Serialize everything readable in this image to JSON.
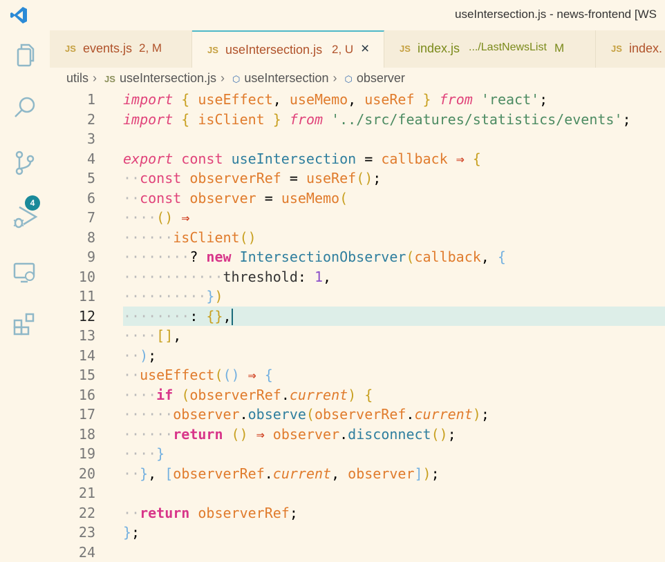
{
  "window": {
    "title": "useIntersection.js - news-frontend [WS"
  },
  "activity_bar": {
    "items": [
      {
        "name": "explorer-icon"
      },
      {
        "name": "search-icon"
      },
      {
        "name": "source-control-icon",
        "badge": "4"
      },
      {
        "name": "run-debug-icon"
      },
      {
        "name": "remote-explorer-icon"
      },
      {
        "name": "extensions-icon"
      }
    ]
  },
  "tabs": [
    {
      "icon": "JS",
      "label": "events.js",
      "status": "2, M",
      "active": false
    },
    {
      "icon": "JS",
      "label": "useIntersection.js",
      "status": "2, U",
      "active": true,
      "close": "×"
    },
    {
      "icon": "JS",
      "label": "index.js",
      "path": ".../LastNewsList",
      "status": "M",
      "active": false
    },
    {
      "icon": "JS",
      "label": "index.",
      "active": false
    }
  ],
  "breadcrumb": {
    "folder": "utils",
    "file_icon": "JS",
    "file": "useIntersection.js",
    "symbol1": "useIntersection",
    "symbol2": "observer"
  },
  "editor": {
    "current_line": 12,
    "line_numbers": [
      "1",
      "2",
      "3",
      "4",
      "5",
      "6",
      "7",
      "8",
      "9",
      "10",
      "11",
      "12",
      "13",
      "14",
      "15",
      "16",
      "17",
      "18",
      "19",
      "20",
      "21",
      "22",
      "23",
      "24"
    ],
    "lines": [
      "import { useEffect, useMemo, useRef } from 'react';",
      "import { isClient } from '../src/features/statistics/events';",
      "",
      "export const useIntersection = callback => {",
      "  const observerRef = useRef();",
      "  const observer = useMemo(",
      "    () =>",
      "      isClient()",
      "        ? new IntersectionObserver(callback, {",
      "            threshold: 1,",
      "          })",
      "        : {},",
      "    [],",
      "  );",
      "  useEffect(() => {",
      "    if (observerRef.current) {",
      "      observer.observe(observerRef.current);",
      "      return () => observer.disconnect();",
      "    }",
      "  }, [observerRef.current, observer]);",
      "",
      "  return observerRef;",
      "};",
      ""
    ]
  },
  "colors": {
    "background": "#FDF6E8",
    "tab_bar": "#F6EDDA",
    "active_tab_border": "#4DB8C8",
    "badge": "#1A8A9A",
    "current_line": "#DDEEE8"
  }
}
